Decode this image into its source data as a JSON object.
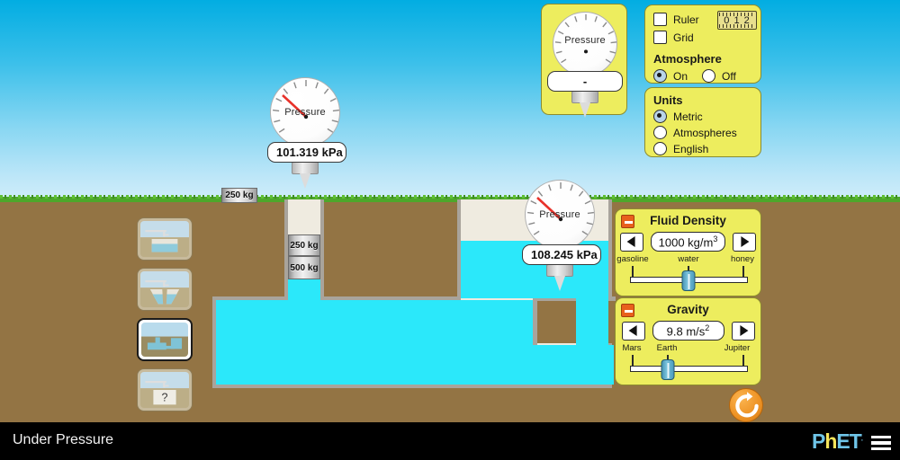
{
  "app": {
    "title": "Under Pressure",
    "logo_text_p": "P",
    "logo_text_h": "h",
    "logo_text_et": "ET",
    "logo_tm": "."
  },
  "colors": {
    "panel_bg": "#EDED5E",
    "panel_border": "#8C8C30",
    "water": "#2BE8FA",
    "ground": "#937444",
    "grass": "#4DA72B",
    "sky_top": "#02ADE2",
    "sky_bottom": "#CFEDFA",
    "accent_orange": "#E8601C",
    "slider_thumb": "#79C2DC",
    "needle_red": "#E8322A"
  },
  "control_panel": {
    "ruler": {
      "label": "Ruler",
      "checked": false
    },
    "grid": {
      "label": "Grid",
      "checked": false
    },
    "ruler_icon_text": "0  1  2",
    "atmosphere": {
      "title": "Atmosphere",
      "options": [
        "On",
        "Off"
      ],
      "selected": "On"
    }
  },
  "units_panel": {
    "title": "Units",
    "options": [
      "Metric",
      "Atmospheres",
      "English"
    ],
    "selected": "Metric"
  },
  "fluid_density": {
    "title": "Fluid Density",
    "value": "1000 kg/m",
    "value_exponent": "3",
    "tick_labels": [
      "gasoline",
      "water",
      "honey"
    ],
    "thumb_percent": 50,
    "left_arrow": "◀",
    "right_arrow": "▶"
  },
  "gravity": {
    "title": "Gravity",
    "value": "9.8 m/s",
    "value_exponent": "2",
    "tick_labels": [
      "Mars",
      "Earth",
      "Jupiter"
    ],
    "thumb_percent": 28,
    "left_arrow": "◀",
    "right_arrow": "▶"
  },
  "gauges": [
    {
      "id": "gauge-floating",
      "label": "Pressure",
      "reading": "101.319 kPa"
    },
    {
      "id": "gauge-in-water",
      "label": "Pressure",
      "reading": "108.245 kPa"
    },
    {
      "id": "gauge-toolbox",
      "label": "Pressure",
      "reading": "-"
    }
  ],
  "masses": [
    {
      "label": "250 kg",
      "location": "ground"
    },
    {
      "label": "250 kg",
      "location": "chamber-upper"
    },
    {
      "label": "500 kg",
      "location": "chamber-lower"
    }
  ],
  "scene_selector": {
    "scenes": [
      {
        "name": "square-pool",
        "selected": false
      },
      {
        "name": "trapezoid-pool",
        "selected": false
      },
      {
        "name": "chamber-pool",
        "selected": true
      },
      {
        "name": "mystery-pool",
        "selected": false,
        "badge": "?"
      }
    ]
  },
  "reset_button": {
    "label": "Reset All",
    "icon": "reset-icon"
  }
}
